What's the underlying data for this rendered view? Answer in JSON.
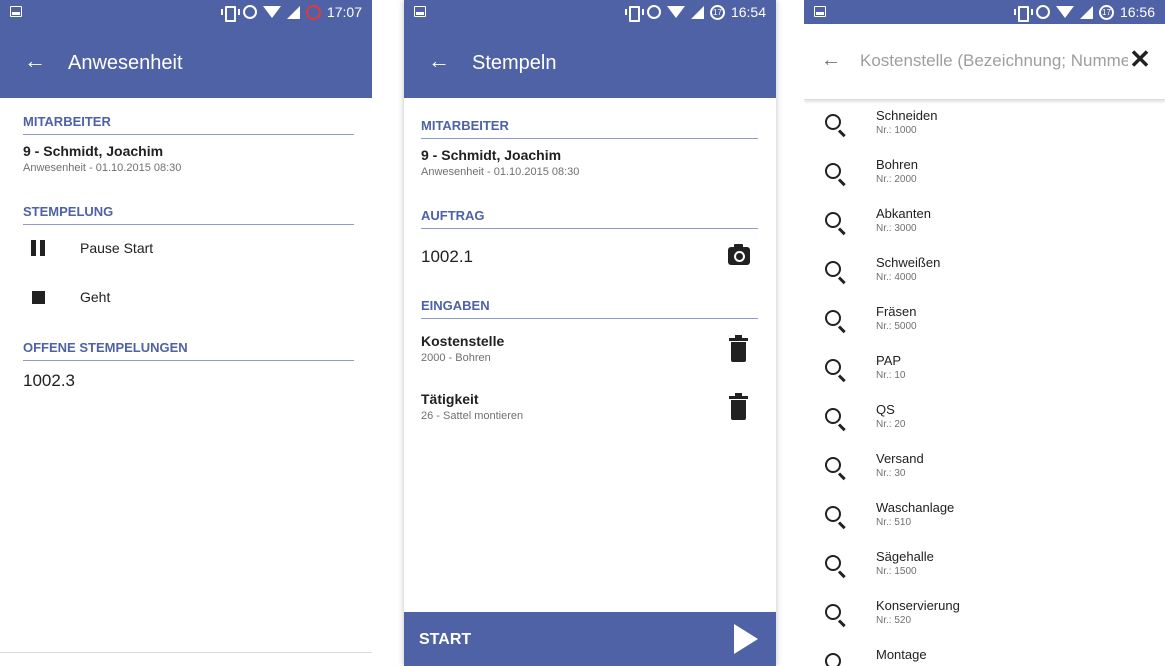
{
  "colors": {
    "primary": "#4f62a5",
    "section_text": "#4f62a5",
    "battery_low": "#e53935"
  },
  "screen1": {
    "status_time": "17:07",
    "title": "Anwesenheit",
    "employee_section": "MITARBEITER",
    "employee_name": "9 - Schmidt, Joachim",
    "employee_sub": "Anwesenheit - 01.10.2015 08:30",
    "stamp_section": "STEMPELUNG",
    "stamp_actions": [
      {
        "icon": "pause-icon",
        "label": "Pause Start"
      },
      {
        "icon": "stop-icon",
        "label": "Geht"
      }
    ],
    "open_section": "OFFENE STEMPELUNGEN",
    "open_items": [
      "1002.3"
    ]
  },
  "screen2": {
    "status_time": "16:54",
    "battery_badge": "17",
    "title": "Stempeln",
    "employee_section": "MITARBEITER",
    "employee_name": "9 - Schmidt, Joachim",
    "employee_sub": "Anwesenheit - 01.10.2015 08:30",
    "order_section": "AUFTRAG",
    "order_value": "1002.1",
    "inputs_section": "EINGABEN",
    "inputs": [
      {
        "title": "Kostenstelle",
        "value": "2000 - Bohren"
      },
      {
        "title": "Tätigkeit",
        "value": "26 - Sattel montieren"
      }
    ],
    "start_label": "START"
  },
  "screen3": {
    "status_time": "16:56",
    "battery_badge": "17",
    "search_placeholder": "Kostenstelle (Bezeichnung; Nummer)",
    "results": [
      {
        "name": "Schneiden",
        "nr": "Nr.: 1000"
      },
      {
        "name": "Bohren",
        "nr": "Nr.: 2000"
      },
      {
        "name": "Abkanten",
        "nr": "Nr.: 3000"
      },
      {
        "name": "Schweißen",
        "nr": "Nr.: 4000"
      },
      {
        "name": "Fräsen",
        "nr": "Nr.: 5000"
      },
      {
        "name": "PAP",
        "nr": "Nr.: 10"
      },
      {
        "name": "QS",
        "nr": "Nr.: 20"
      },
      {
        "name": "Versand",
        "nr": "Nr.: 30"
      },
      {
        "name": "Waschanlage",
        "nr": "Nr.: 510"
      },
      {
        "name": "Sägehalle",
        "nr": "Nr.: 1500"
      },
      {
        "name": "Konservierung",
        "nr": "Nr.: 520"
      },
      {
        "name": "Montage",
        "nr": ""
      }
    ]
  }
}
